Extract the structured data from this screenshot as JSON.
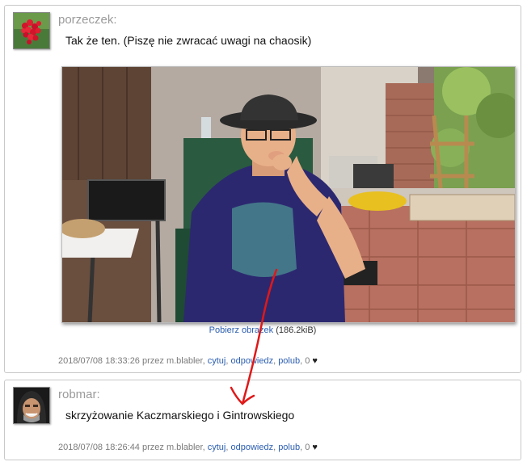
{
  "posts": [
    {
      "author": "porzeczek:",
      "text": "Tak że ten. (Piszę nie zwracać uwagi na chaosik)",
      "attachment": {
        "download_label": "Pobierz obrazek",
        "size": "(186.2kiB)"
      },
      "meta": {
        "datetime": "2018/07/08 18:33:26",
        "by": "przez m.blabler,",
        "quote": "cytuj",
        "reply": "odpowiedz",
        "like": "polub",
        "count": "0",
        "separator": ","
      }
    },
    {
      "author": "robmar:",
      "text": "skrzyżowanie Kaczmarskiego i Gintrowskiego",
      "meta": {
        "datetime": "2018/07/08 18:26:44",
        "by": "przez m.blabler,",
        "quote": "cytuj",
        "reply": "odpowiedz",
        "like": "polub",
        "count": "0",
        "separator": ","
      }
    }
  ],
  "colors": {
    "link": "#2a5db0",
    "annotation": "#e01818",
    "author": "#9a9a9a"
  },
  "icons": {
    "heart": "heart-icon",
    "avatar1": "berries-avatar",
    "avatar2": "hooded-face-avatar"
  }
}
